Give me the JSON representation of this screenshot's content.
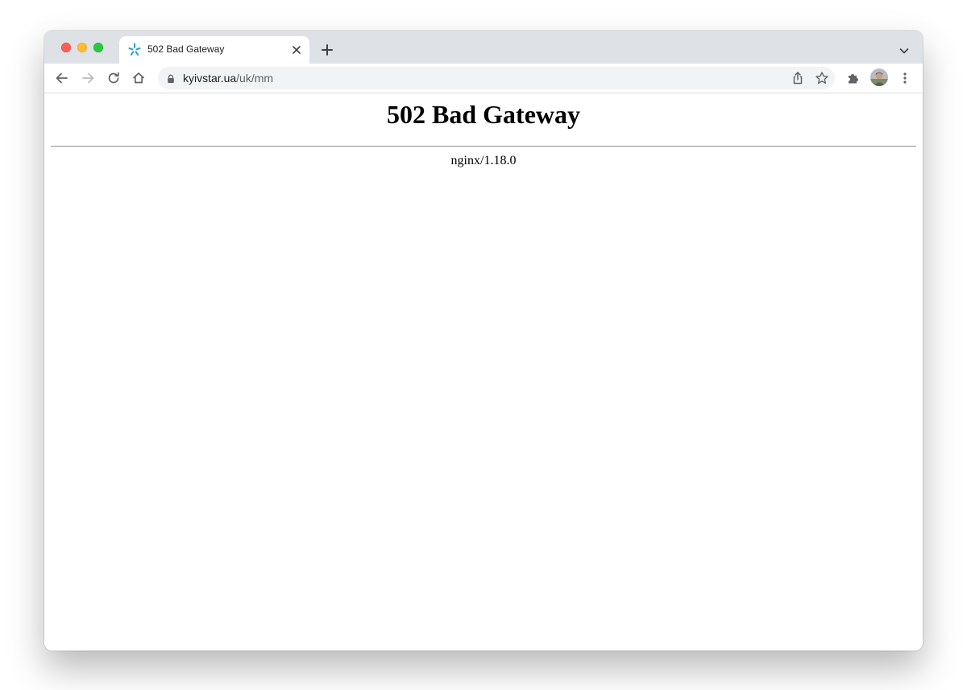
{
  "browser": {
    "tab": {
      "title": "502 Bad Gateway",
      "favicon": "kyivstar-star-icon",
      "favicon_color": "#2a9fd6"
    },
    "address_bar": {
      "host": "kyivstar.ua",
      "path": "/uk/mm"
    },
    "icons": {
      "back": "arrow-left-icon",
      "forward": "arrow-right-icon",
      "reload": "reload-icon",
      "home": "home-icon",
      "share": "share-icon",
      "bookmark": "star-icon",
      "extensions": "puzzle-icon",
      "menu": "kebab-menu-icon"
    },
    "colors": {
      "tabstrip": "#dee1e6",
      "omnibox": "#f1f3f4",
      "close": "#ff5f57",
      "minimize": "#febc2e",
      "maximize": "#28c840"
    }
  },
  "page": {
    "heading": "502 Bad Gateway",
    "footer": "nginx/1.18.0"
  }
}
